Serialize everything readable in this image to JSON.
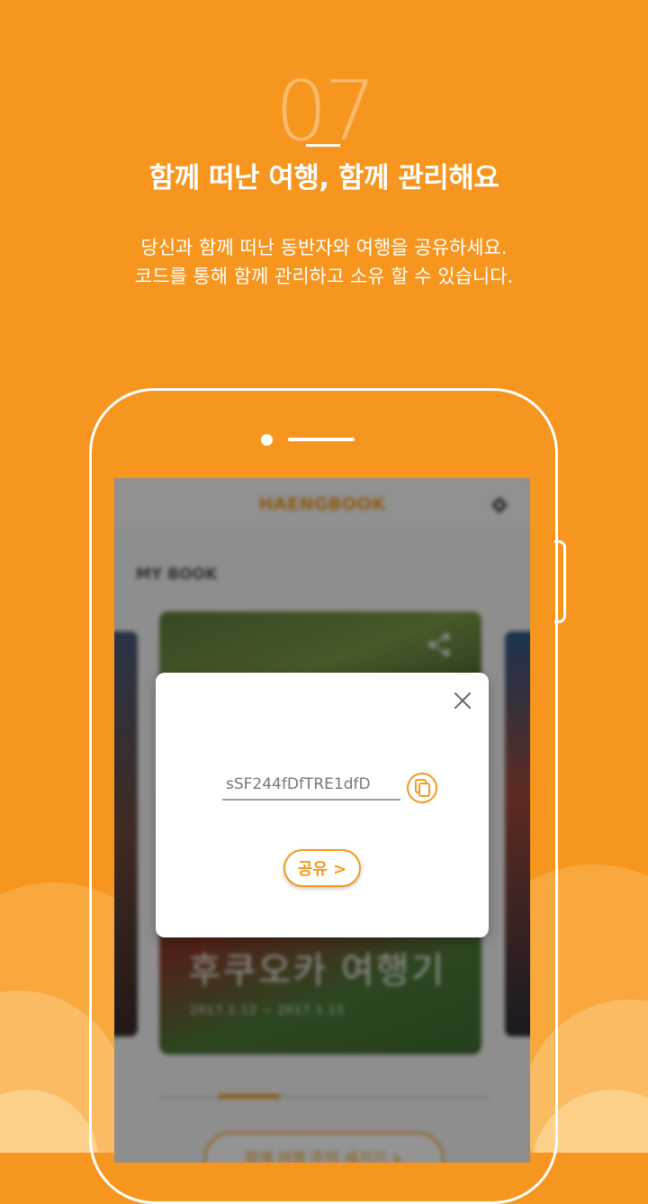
{
  "colors": {
    "background": "#f7961e",
    "accent": "#f39a1e",
    "white": "#ffffff"
  },
  "step": {
    "number": "07"
  },
  "headline": "함께 떠난 여행, 함께 관리해요",
  "description": {
    "line1": "당신과 함께 떠난 동반자와 여행을 공유하세요.",
    "line2": "코드를 통해 함께 관리하고 소유 할 수 있습니다."
  },
  "app": {
    "title": "HAENGBOOK",
    "section_title": "MY BOOK",
    "book": {
      "title": "후쿠오카 여행기",
      "dates": "2017.1.12 ~ 2017.1.15"
    },
    "bottom_button_label": "함께 여행 추억 새기기 +",
    "carousel_progress": 0.2
  },
  "modal": {
    "share_code": "sSF244fDfTRE1dfD",
    "share_button_label": "공유 >"
  },
  "icons": {
    "settings": "gear-icon",
    "share": "share-icon",
    "close": "close-icon",
    "copy": "copy-icon"
  }
}
